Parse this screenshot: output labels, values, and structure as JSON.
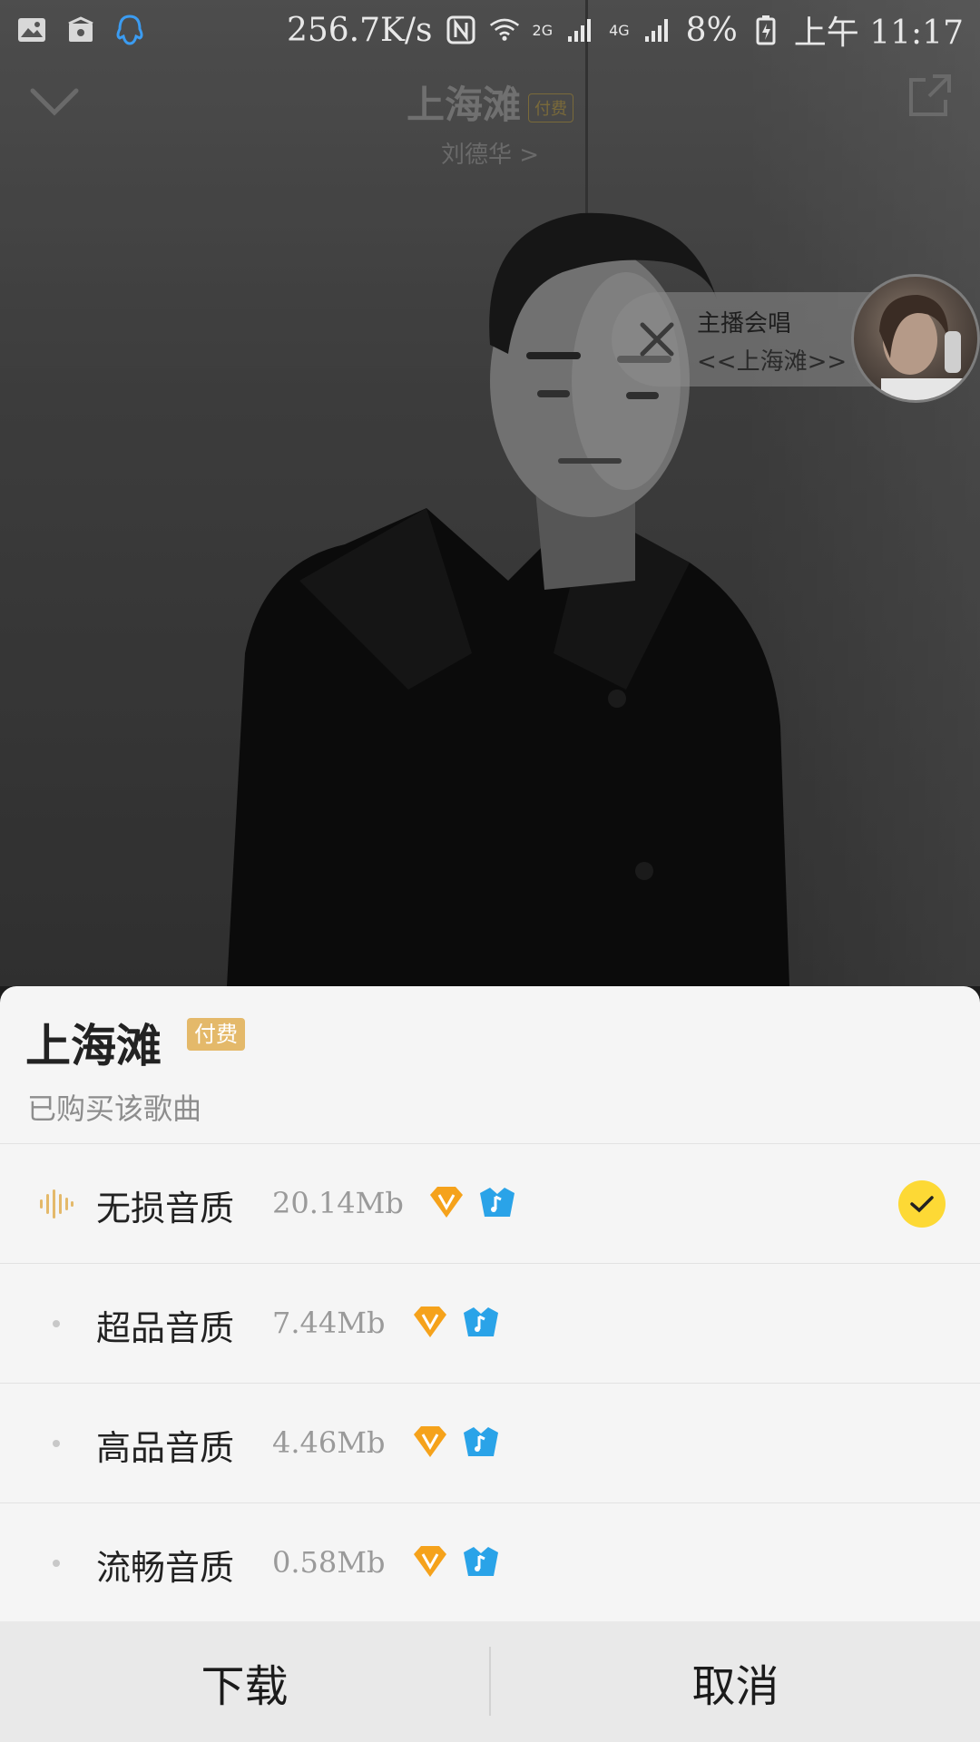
{
  "status_bar": {
    "speed": "256.7K/s",
    "net_2g": "2G",
    "net_4g": "4G",
    "battery": "8%",
    "time": "上午 11:17"
  },
  "player": {
    "song_title": "上海滩",
    "song_tag": "付费",
    "artist": "刘德华 >"
  },
  "live_bubble": {
    "title": "主播会唱",
    "song": "<<上海滩>>"
  },
  "sheet": {
    "title": "上海滩",
    "badge": "付费",
    "subtitle": "已购买该歌曲",
    "qualities": [
      {
        "name": "无损音质",
        "size": "20.14Mb",
        "selected": true
      },
      {
        "name": "超品音质",
        "size": "7.44Mb",
        "selected": false
      },
      {
        "name": "高品音质",
        "size": "4.46Mb",
        "selected": false
      },
      {
        "name": "流畅音质",
        "size": "0.58Mb",
        "selected": false
      }
    ],
    "download_label": "下载",
    "cancel_label": "取消"
  },
  "colors": {
    "accent_yellow": "#fdd935",
    "badge_gold": "#e4b96a",
    "vip_orange": "#f5a21b",
    "vip_blue": "#2aa3e8"
  }
}
